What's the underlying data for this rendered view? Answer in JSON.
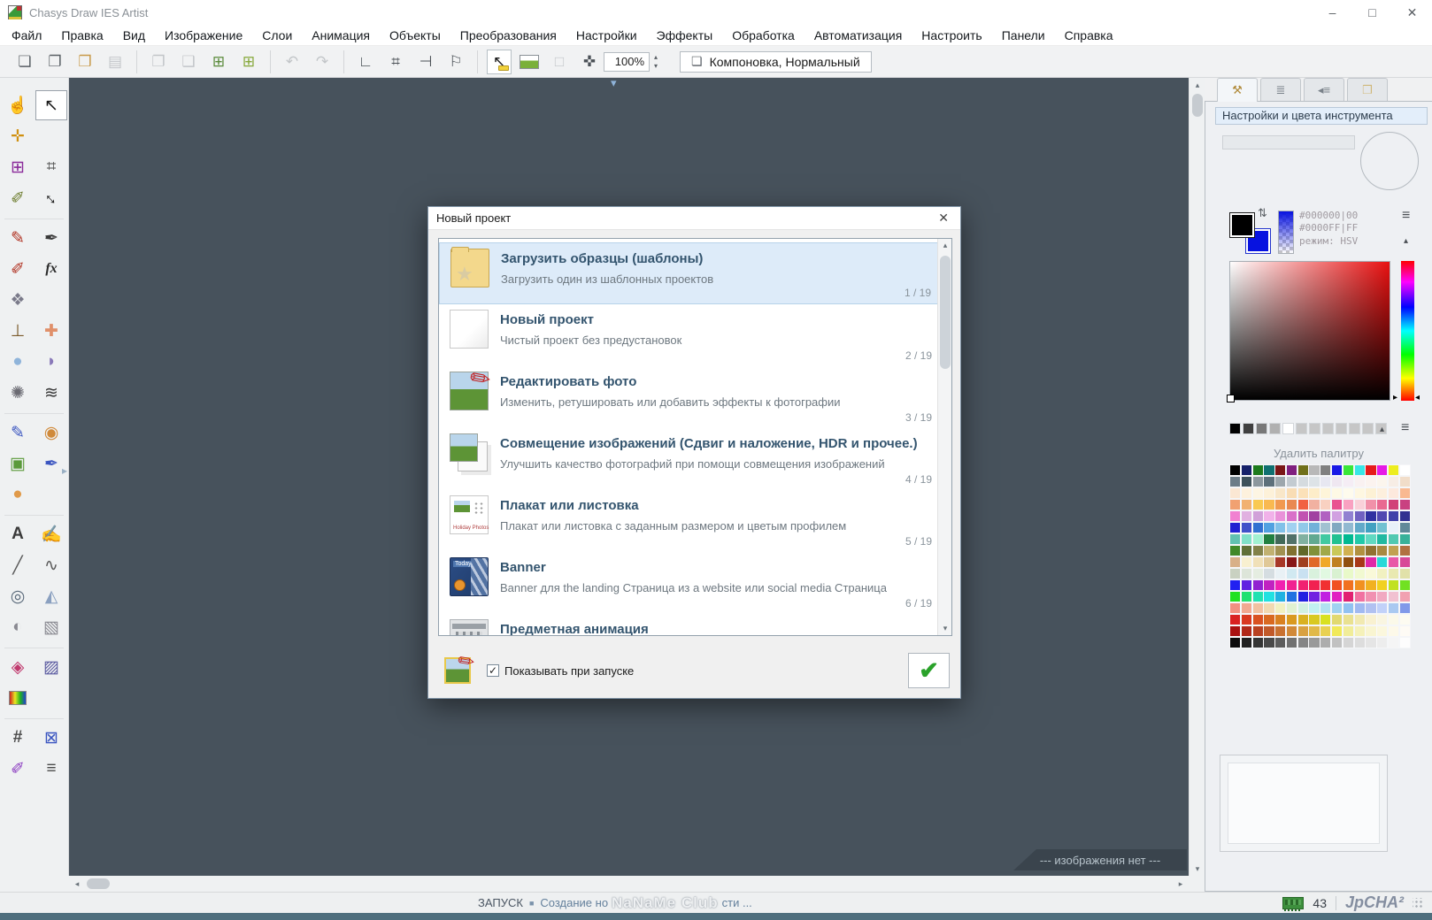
{
  "ui": {
    "arrows": {
      "up": "▴",
      "down": "▾",
      "left": "◂",
      "right": "▸"
    },
    "menu_glyph": "≡",
    "bullet": "■"
  },
  "window": {
    "title": "Chasys Draw IES Artist",
    "controls": {
      "minimize": "–",
      "maximize": "□",
      "close": "✕"
    }
  },
  "menu": {
    "items": [
      "Файл",
      "Правка",
      "Вид",
      "Изображение",
      "Слои",
      "Анимация",
      "Объекты",
      "Преобразования",
      "Настройки",
      "Эффекты",
      "Обработка",
      "Автоматизация",
      "Настроить",
      "Панели",
      "Справка"
    ]
  },
  "toolbar": {
    "zoom": {
      "value": "100%"
    },
    "layout": {
      "icon": "❏",
      "label": "Компоновка, Нормальный"
    },
    "groups": [
      [
        {
          "name": "new-file-icon",
          "glyph": "❏",
          "color": "#5a6066"
        },
        {
          "name": "new-from-template-icon",
          "glyph": "❐",
          "color": "#5a6066"
        },
        {
          "name": "open-file-icon",
          "glyph": "❒",
          "color": "#c89a4a"
        },
        {
          "name": "save-icon",
          "glyph": "▤",
          "color": "#8a9096",
          "disabled": true
        }
      ],
      [
        {
          "name": "copy-icon",
          "glyph": "❐",
          "color": "#8a9096",
          "disabled": true
        },
        {
          "name": "paste-icon",
          "glyph": "❑",
          "color": "#8a9096",
          "disabled": true
        },
        {
          "name": "add-layer-icon",
          "glyph": "⊞",
          "color": "#5a8a3a"
        },
        {
          "name": "add-image-layer-icon",
          "glyph": "⊞",
          "color": "#86a83a"
        }
      ],
      [
        {
          "name": "undo-icon",
          "glyph": "↶",
          "color": "#8a9096",
          "disabled": true
        },
        {
          "name": "redo-icon",
          "glyph": "↷",
          "color": "#8a9096",
          "disabled": true
        }
      ],
      [
        {
          "name": "rulers-icon",
          "glyph": "∟",
          "color": "#4a5056"
        },
        {
          "name": "grid-snap-icon",
          "glyph": "⌗",
          "color": "#4a5056"
        },
        {
          "name": "snap-edges-icon",
          "glyph": "⊣",
          "color": "#4a5056"
        },
        {
          "name": "snap-guides-icon",
          "glyph": "⚐",
          "color": "#4a5056"
        }
      ],
      [
        {
          "name": "pointer-hint-icon",
          "glyph": "↖",
          "color": "#1a1a1a",
          "type": "pointer-hint",
          "active": true
        },
        {
          "name": "background-preview-icon",
          "type": "mini-image"
        },
        {
          "name": "frame-icon",
          "glyph": "□",
          "color": "#8a9096",
          "disabled": true
        },
        {
          "name": "fit-screen-icon",
          "glyph": "✜",
          "color": "#4a5056"
        }
      ]
    ]
  },
  "tool_palette": {
    "rows": [
      {
        "cells": [
          {
            "name": "pan-tool",
            "glyph": "☝",
            "color": "#4a4a4a"
          },
          {
            "name": "move-tool",
            "glyph": "↖",
            "color": "#1a1a1a",
            "selected": true
          }
        ]
      },
      {
        "cells": [
          {
            "name": "pin-tool",
            "glyph": "✛",
            "color": "#d09010"
          },
          null
        ]
      },
      {
        "cells": [
          {
            "name": "select-tool",
            "glyph": "⊞",
            "color": "#8a2a9a"
          },
          {
            "name": "crop-tool",
            "glyph": "⌗",
            "color": "#4a4a4a"
          }
        ]
      },
      {
        "cells": [
          {
            "name": "sample-tool",
            "glyph": "✐",
            "color": "#6a7a2a"
          },
          {
            "name": "resize-tool",
            "glyph": "↔",
            "color": "#1a1a1a",
            "rotate": true
          }
        ]
      },
      {
        "sep": true
      },
      {
        "cells": [
          {
            "name": "pencil-tool",
            "glyph": "✎",
            "color": "#b03020"
          },
          {
            "name": "color-picker-tool",
            "glyph": "✒",
            "color": "#3a3a3a"
          }
        ]
      },
      {
        "cells": [
          {
            "name": "brush-tool",
            "glyph": "✐",
            "color": "#b03020"
          },
          {
            "name": "fx-brush-tool",
            "type": "fx",
            "label": "fx",
            "color": "#2a2a2a"
          }
        ]
      },
      {
        "cells": [
          {
            "name": "pattern-brush-tool",
            "glyph": "❖",
            "color": "#7a7a8a"
          },
          null
        ]
      },
      {
        "cells": [
          {
            "name": "stamp-tool",
            "glyph": "⊥",
            "color": "#7a5a2a"
          },
          {
            "name": "heal-tool",
            "glyph": "✚",
            "color": "#e0906a"
          }
        ]
      },
      {
        "cells": [
          {
            "name": "waterdrop-tool",
            "glyph": "●",
            "color": "#8fb4da"
          },
          {
            "name": "smudge-tool",
            "glyph": "◗",
            "color": "#8878b8"
          }
        ]
      },
      {
        "cells": [
          {
            "name": "splat-tool",
            "glyph": "✺",
            "color": "#6a6a72"
          },
          {
            "name": "zigzag-tool",
            "glyph": "≋",
            "color": "#3a3a3a"
          }
        ]
      },
      {
        "sep": true
      },
      {
        "cells": [
          {
            "name": "airbrush-tool",
            "glyph": "✎",
            "color": "#3a55c0"
          },
          {
            "name": "dodge-tool",
            "glyph": "◉",
            "color": "#d08a3a"
          }
        ]
      },
      {
        "cells": [
          {
            "name": "image-edit-tool",
            "glyph": "▣",
            "color": "#5a9a3a"
          },
          {
            "name": "pen-tool",
            "glyph": "✒",
            "color": "#3a55c0"
          }
        ]
      },
      {
        "cells": [
          {
            "name": "sphere-tool",
            "glyph": "●",
            "color": "#e09a4a"
          },
          null
        ]
      },
      {
        "sep": true
      },
      {
        "cells": [
          {
            "name": "text-tool",
            "glyph": "A",
            "color": "#3a3a3a",
            "bold": true
          },
          {
            "name": "freehand-text-tool",
            "glyph": "✍",
            "color": "#3a3a3a"
          }
        ]
      },
      {
        "cells": [
          {
            "name": "line-tool",
            "glyph": "╱",
            "color": "#5a5a5a"
          },
          {
            "name": "curve-tool",
            "glyph": "∿",
            "color": "#5a5a5a"
          }
        ]
      },
      {
        "cells": [
          {
            "name": "shapes-tool",
            "glyph": "◎",
            "color": "#5a6a7a"
          },
          {
            "name": "polygon-tool",
            "glyph": "◭",
            "color": "#8aa0c0"
          }
        ]
      },
      {
        "cells": [
          {
            "name": "spheres-tool",
            "glyph": "◐",
            "color": "#8a8a92"
          },
          {
            "name": "box3d-tool",
            "glyph": "▧",
            "color": "#8a8a92"
          }
        ]
      },
      {
        "sep": true
      },
      {
        "cells": [
          {
            "name": "fill-tool",
            "glyph": "◈",
            "color": "#c03a6e"
          },
          {
            "name": "spray-fill-tool",
            "glyph": "▨",
            "color": "#5a5aa0"
          }
        ]
      },
      {
        "cells": [
          {
            "name": "gradient-tool",
            "type": "gradient"
          },
          null
        ]
      },
      {
        "sep": true
      },
      {
        "cells": [
          {
            "name": "grid-tool",
            "glyph": "#",
            "color": "#4a4a4a",
            "bold": true
          },
          {
            "name": "mesh-warp-tool",
            "glyph": "⊠",
            "color": "#3a55c0"
          }
        ]
      },
      {
        "cells": [
          {
            "name": "magic-pen-tool",
            "glyph": "✐",
            "color": "#8a3ac0"
          },
          {
            "name": "adjust-tool",
            "glyph": "≡",
            "color": "#4a4a4a"
          }
        ]
      }
    ]
  },
  "canvas": {
    "no_image_label": "--- изображения нет ---"
  },
  "dialog": {
    "title": "Новый проект",
    "close_glyph": "✕",
    "items": [
      {
        "icon": "folder-star",
        "star": "★",
        "title": "Загрузить образцы (шаблоны)",
        "subtitle": "Загрузить один из шаблонных проектов",
        "counter": "1 / 19",
        "selected": true
      },
      {
        "icon": "blank",
        "title": "Новый проект",
        "subtitle": "Чистый проект без предустановок",
        "counter": "2 / 19"
      },
      {
        "icon": "photo-edit",
        "title": "Редактировать фото",
        "subtitle": "Изменить, ретушировать или добавить эффекты к фотографии",
        "counter": "3 / 19"
      },
      {
        "icon": "photo-stack",
        "title": "Совмещение изображений (Сдвиг и наложение, HDR и прочее.)",
        "subtitle": "Улучшить качество фотографий при помощи совмещения изображений",
        "counter": "4 / 19"
      },
      {
        "icon": "poster",
        "caption": "Holiday Photos",
        "title": "Плакат или листовка",
        "subtitle": "Плакат или листовка с заданным размером и цветым профилем",
        "counter": "5 / 19"
      },
      {
        "icon": "banner",
        "caption": "Today",
        "title": "Banner",
        "subtitle": "Banner для the landing Страница из a website или social media Страница",
        "counter": "6 / 19"
      },
      {
        "icon": "building",
        "title": "Предметная анимация"
      }
    ],
    "footer": {
      "checkbox_label": "Показывать при запуске",
      "checked": true,
      "check_glyph": "✓",
      "ok_glyph": "✔"
    }
  },
  "right_panel": {
    "header": "Настройки и цвета инструмента",
    "tabs": [
      {
        "name": "tab-tool-settings",
        "glyph": "⚒",
        "color": "#b08a3a",
        "active": true
      },
      {
        "name": "tab-layers",
        "glyph": "≣",
        "color": "#7a828a"
      },
      {
        "name": "tab-object-list",
        "glyph": "◂≡",
        "color": "#7a828a"
      },
      {
        "name": "tab-files",
        "glyph": "❒",
        "color": "#d0b87a"
      }
    ],
    "color": {
      "fg": "#000000",
      "bg": "#0712e0",
      "fg_line": "#000000|00",
      "bg_line": "#0000FF|FF",
      "mode": "режим: HSV",
      "swap_glyph": "⇅"
    },
    "gray_swatches": [
      "#000000",
      "#3f3f3f",
      "#787878",
      "#b0b0b0",
      "#ffffff",
      "#c6c6c6",
      "#c6c6c6",
      "#c6c6c6",
      "#c6c6c6",
      "#c6c6c6",
      "#c6c6c6",
      "#c6c6c6"
    ],
    "delete_palette_label": "Удалить палитру",
    "palette_rows": [
      [
        "#000000",
        "#16216a",
        "#1d7a1d",
        "#0f7070",
        "#7a1616",
        "#80207f",
        "#70701a",
        "#b8b8b8",
        "#808080",
        "#1a1ae6",
        "#39e639",
        "#39e6e6",
        "#e61a1a",
        "#e61ae6",
        "#eded1f",
        "#ffffff"
      ],
      [
        "#6d7d88",
        "#3d515b",
        "#8b979e",
        "#5d707b",
        "#9da7ad",
        "#c3cbd1",
        "#d5dbdf",
        "#dde3e7",
        "#e7e7f1",
        "#efe7f1",
        "#f5edf5",
        "#f9f1f1",
        "#fbf3ef",
        "#fbf5ed",
        "#f7ede5",
        "#f1ddc9"
      ],
      [
        "#fbe7d3",
        "#fdf1dd",
        "#fdf5e3",
        "#fdf1d9",
        "#f9e7c9",
        "#f9ddb5",
        "#fbe1b9",
        "#fdedc9",
        "#fef5d9",
        "#fef9e5",
        "#fefbed",
        "#fef7e1",
        "#fdf1d5",
        "#fdefdd",
        "#fde9dd",
        "#f9b991"
      ],
      [
        "#f1a171",
        "#f1b171",
        "#f9c951",
        "#f9b951",
        "#f19951",
        "#e98951",
        "#f16141",
        "#f1b1a1",
        "#f9d1c1",
        "#e95191",
        "#f9a1c1",
        "#f9d1d9",
        "#f191a9",
        "#e96991",
        "#d14179",
        "#c94181"
      ],
      [
        "#f181d1",
        "#e1b1e1",
        "#d1a1d9",
        "#f1b1e9",
        "#e991d9",
        "#d971c9",
        "#c151b1",
        "#a141a1",
        "#b161c1",
        "#d1a1e1",
        "#9181d1",
        "#7161c1",
        "#3131a1",
        "#5149b1",
        "#4141a9",
        "#313191"
      ],
      [
        "#2121d1",
        "#4151c9",
        "#3171d1",
        "#51a1e1",
        "#81c1e9",
        "#a1d1f1",
        "#91c9e9",
        "#71b1d9",
        "#a1c1d1",
        "#81a9c1",
        "#91b9d1",
        "#61a9c9",
        "#41a1c1",
        "#71c1d1",
        "#e9f1f9",
        "#618999"
      ],
      [
        "#61c1b1",
        "#81e1c9",
        "#a1f1d1",
        "#218041",
        "#416959",
        "#517169",
        "#81b1a1",
        "#61a991",
        "#41c9a1",
        "#21c191",
        "#01b991",
        "#21c9a9",
        "#61d9c1",
        "#21b9a1",
        "#51c9b1",
        "#39b199"
      ],
      [
        "#418929",
        "#617139",
        "#818149",
        "#c1b171",
        "#a19151",
        "#817131",
        "#616929",
        "#819139",
        "#a1a949",
        "#c9c959",
        "#d1b151",
        "#b19141",
        "#917131",
        "#a98941",
        "#c1a151",
        "#b17141"
      ],
      [
        "#d8b088",
        "#f8f0d0",
        "#f0e0b8",
        "#e0c898",
        "#a83828",
        "#881818",
        "#a04020",
        "#e06828",
        "#f0a828",
        "#c08020",
        "#905010",
        "#a83818",
        "#e028a8",
        "#28d8d8",
        "#e858a8",
        "#d84898"
      ],
      [
        "#c9d1c1",
        "#dde5d9",
        "#e5ede1",
        "#d5dde1",
        "#e9f1f5",
        "#d1e9f1",
        "#c9e1f1",
        "#d9f1dd",
        "#e1f9e1",
        "#d9f1d1",
        "#e9f9c9",
        "#f1f9d1",
        "#f9f9d9",
        "#f1f1c1",
        "#e9e9b1",
        "#e1e1a9"
      ],
      [
        "#2121f1",
        "#6121e1",
        "#9121d1",
        "#c121c1",
        "#f121b1",
        "#f12191",
        "#f12171",
        "#f12151",
        "#f13131",
        "#f15121",
        "#f17121",
        "#f19121",
        "#f1b121",
        "#f1d121",
        "#c1e121",
        "#71e121"
      ],
      [
        "#21e121",
        "#21e171",
        "#21e1b1",
        "#21e1e1",
        "#21b1e1",
        "#2171e1",
        "#2121e1",
        "#7121e1",
        "#c121e1",
        "#e121c1",
        "#e12171",
        "#f171a1",
        "#f191b1",
        "#f1a9c1",
        "#f1c1d1",
        "#f1a1b1"
      ],
      [
        "#f19181",
        "#f1a991",
        "#f1c1a1",
        "#f1d9b1",
        "#f1f1c1",
        "#e1f1d1",
        "#d1f1e1",
        "#c1f1f1",
        "#b1e1f1",
        "#a1d1f1",
        "#91c1f1",
        "#a1b9f1",
        "#b1c1f1",
        "#c1d1f9",
        "#a9c9f1",
        "#8199e9"
      ],
      [
        "#d92121",
        "#d93921",
        "#d95121",
        "#d96921",
        "#d98121",
        "#d99921",
        "#d9b121",
        "#d9c921",
        "#d9e121",
        "#e1d971",
        "#e9e191",
        "#f1e9b1",
        "#f9f1d1",
        "#f9f5e1",
        "#fbf9e9",
        "#fdfbf1"
      ],
      [
        "#a91111",
        "#b12919",
        "#b94121",
        "#c15929",
        "#c97131",
        "#d18939",
        "#d9a141",
        "#e1b949",
        "#e9d151",
        "#f1e959",
        "#f1ed99",
        "#f5f1b9",
        "#f9f5d1",
        "#fbf7dd",
        "#fdf9e9",
        "#fefbf5"
      ],
      [
        "#0d0d0d",
        "#212121",
        "#353535",
        "#494949",
        "#5d5d5d",
        "#717171",
        "#858585",
        "#999999",
        "#adadad",
        "#c1c1c1",
        "#d5d5d5",
        "#dddddd",
        "#e5e5e5",
        "#ededed",
        "#f5f5f5",
        "#fdfdfd"
      ]
    ]
  },
  "status_bar": {
    "prefix": "ЗАПУСК",
    "msg_start": "Создание но",
    "watermark": "NaNaMe Club",
    "msg_end": "сти ...",
    "memory_value": "43",
    "brand": "JpCHA²"
  }
}
